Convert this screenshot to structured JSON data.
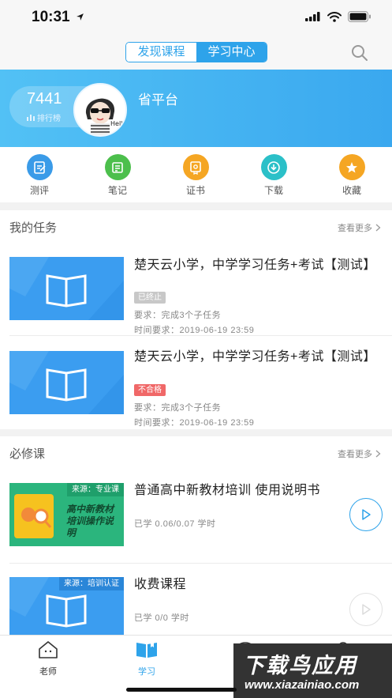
{
  "status": {
    "time": "10:31"
  },
  "nav": {
    "tabs": [
      "发现课程",
      "学习中心"
    ],
    "active_tab": 1
  },
  "profile": {
    "score": "7441",
    "rank_label": "排行榜",
    "platform": "省平台"
  },
  "quick_actions": [
    {
      "label": "测评",
      "icon": "assessment-icon",
      "color": "#3a9be8"
    },
    {
      "label": "笔记",
      "icon": "note-icon",
      "color": "#4cbf4c"
    },
    {
      "label": "证书",
      "icon": "certificate-icon",
      "color": "#f5a623"
    },
    {
      "label": "下载",
      "icon": "download-icon",
      "color": "#2bc0c8"
    },
    {
      "label": "收藏",
      "icon": "star-icon",
      "color": "#f5a623"
    }
  ],
  "tasks_section": {
    "title": "我的任务",
    "more": "查看更多",
    "items": [
      {
        "title": "楚天云小学，中学学习任务+考试【测试】",
        "status": "已终止",
        "status_color": "#c8c8c8",
        "requirement": "要求：完成3个子任务",
        "deadline": "时间要求：2019-06-19 23:59"
      },
      {
        "title": "楚天云小学，中学学习任务+考试【测试】",
        "status": "不合格",
        "status_color": "#f06868",
        "requirement": "要求：完成3个子任务",
        "deadline": "时间要求：2019-06-19 23:59"
      }
    ]
  },
  "required_section": {
    "title": "必修课",
    "more": "查看更多",
    "items": [
      {
        "source": "来源：专业课",
        "thumb_text": "高中新教材培训操作说明",
        "title": "普通高中新教材培训 使用说明书",
        "progress": "已学 0.06/0.07 学时"
      },
      {
        "source": "来源：培训认证",
        "title": "收费课程",
        "progress": "已学 0/0 学时"
      }
    ]
  },
  "tab_bar": [
    {
      "label": "老师",
      "icon": "teacher-icon",
      "color": "#333333"
    },
    {
      "label": "学习",
      "icon": "book-icon",
      "color": "#2ea3ea"
    },
    {
      "label": "",
      "icon": "message-icon",
      "color": "#333333"
    },
    {
      "label": "",
      "icon": "profile-icon",
      "color": "#333333"
    }
  ],
  "watermark": {
    "main": "下载鸟应用",
    "sub": "www.xiazainiao.com"
  }
}
